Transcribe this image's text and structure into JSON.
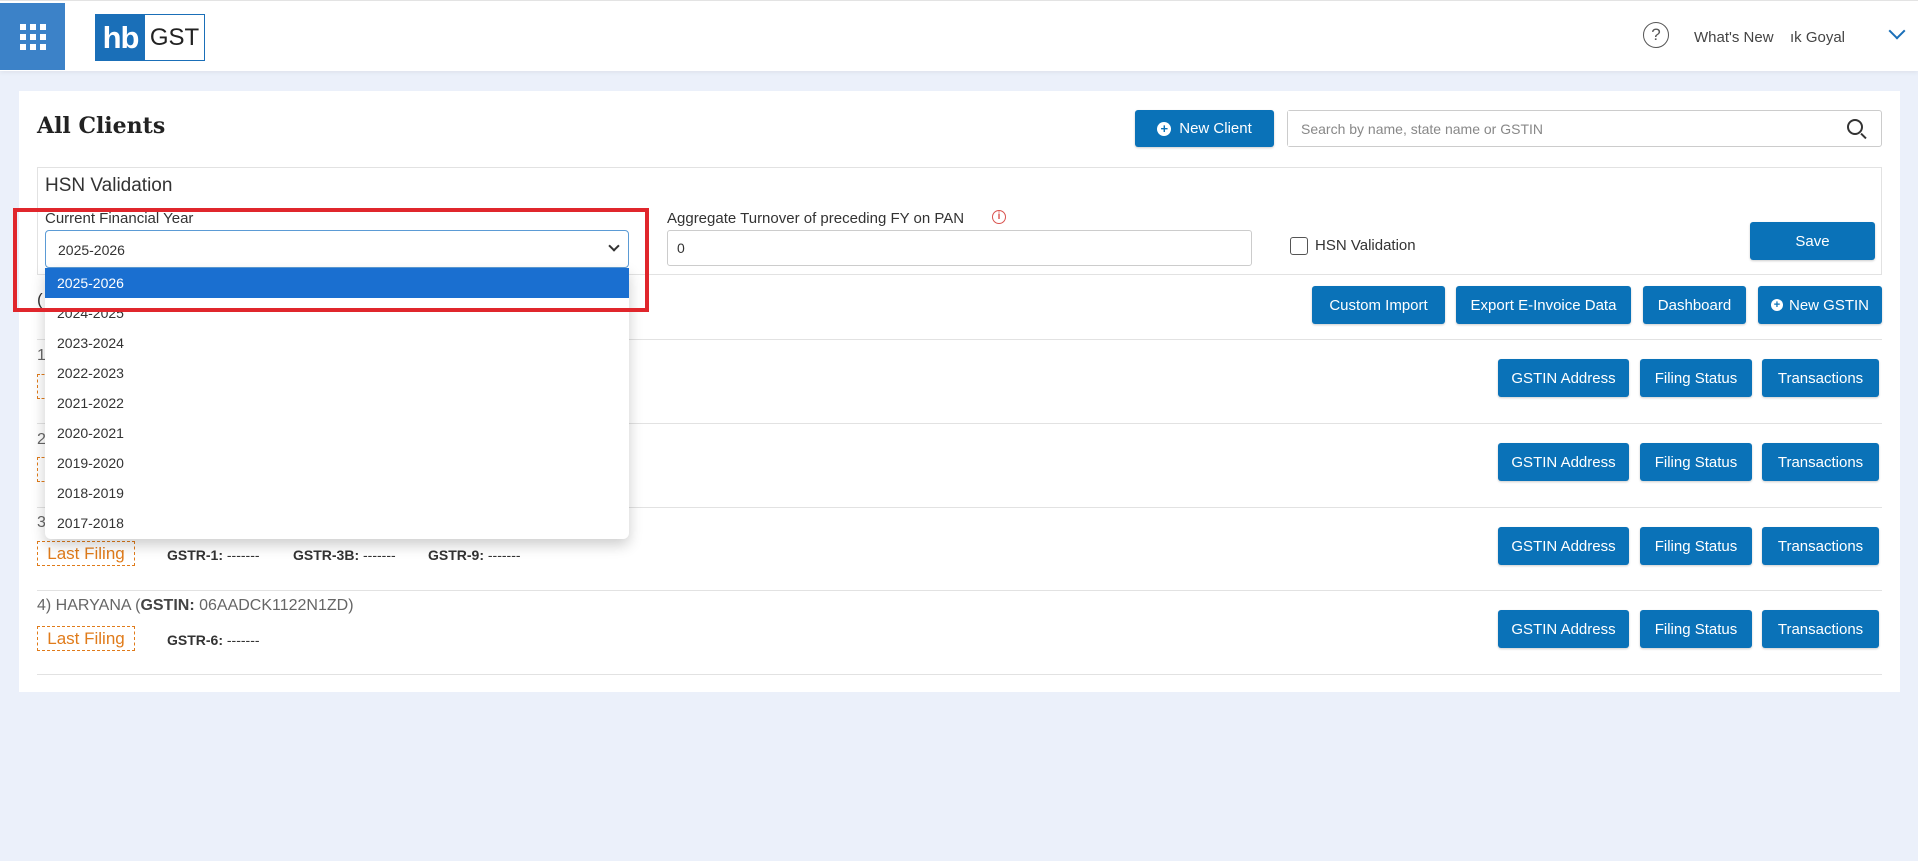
{
  "header": {
    "logo_hb": "hb",
    "logo_gst": "GST",
    "help_symbol": "?",
    "whats_new": "What's New",
    "user_name": "ık Goyal",
    "icons": [
      "apps-grid-icon",
      "help-icon",
      "chevron-down-icon"
    ]
  },
  "main": {
    "title": "All Clients",
    "new_client_label": "New Client",
    "search_placeholder": "Search by name, state name or GSTIN"
  },
  "hsn": {
    "title": "HSN Validation",
    "fy_label": "Current Financial Year",
    "fy_selected": "2025-2026",
    "turnover_label": "Aggregate Turnover of preceding FY on PAN",
    "turnover_value": "0",
    "checkbox_label": "HSN Validation",
    "checkbox_checked": false,
    "save_label": "Save",
    "fy_options": [
      "2025-2026",
      "2024-2025",
      "2023-2024",
      "2022-2023",
      "2021-2022",
      "2020-2021",
      "2019-2020",
      "2018-2019",
      "2017-2018"
    ]
  },
  "toolbar": {
    "custom_import": "Custom Import",
    "export_einvoice": "Export E-Invoice Data",
    "dashboard": "Dashboard",
    "new_gstin": "New GSTIN",
    "partial_char": "("
  },
  "rows": [
    {
      "num": "1",
      "actions": [
        "GSTIN Address",
        "Filing Status",
        "Transactions"
      ]
    },
    {
      "num": "2",
      "actions": [
        "GSTIN Address",
        "Filing Status",
        "Transactions"
      ]
    },
    {
      "num": "3",
      "last_filing": "Last Filing",
      "gstr1_label": "GSTR-1:",
      "gstr1_value": "-------",
      "gstr3b_label": "GSTR-3B:",
      "gstr3b_value": "-------",
      "gstr9_label": "GSTR-9:",
      "gstr9_value": "-------",
      "actions": [
        "GSTIN Address",
        "Filing Status",
        "Transactions"
      ]
    },
    {
      "prefix": "4) HARYANA (",
      "gstin_label": "GSTIN:",
      "gstin": " 06AADCK1122N1ZD)",
      "last_filing": "Last Filing",
      "gstr6_label": "GSTR-6:",
      "gstr6_value": "-------",
      "actions": [
        "GSTIN Address",
        "Filing Status",
        "Transactions"
      ]
    }
  ],
  "colors": {
    "primary": "#0a72b8",
    "accent_orange": "#e07b1a",
    "highlight_red": "#e0262c",
    "background": "#ebf0fa"
  }
}
